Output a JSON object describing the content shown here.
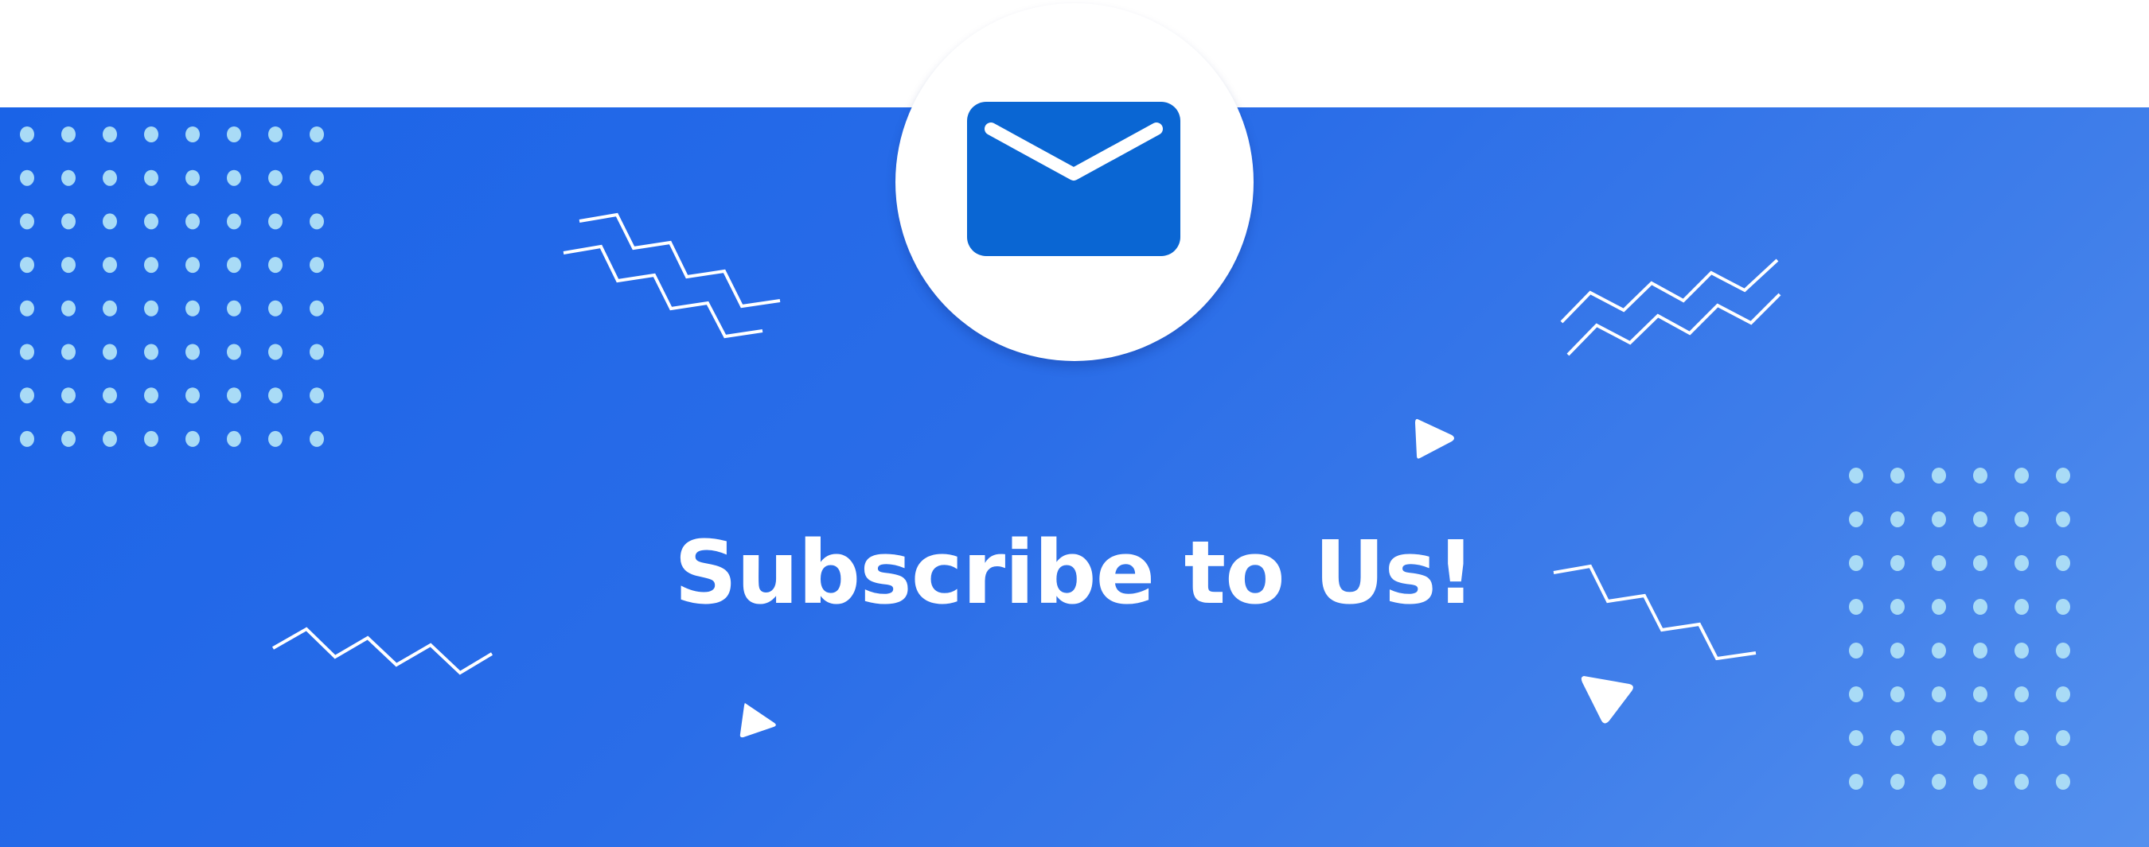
{
  "banner": {
    "headline": "Subscribe to Us!",
    "icon": "envelope-icon",
    "colors": {
      "background_start": "#1a63e7",
      "background_end": "#5490ee",
      "dot": "#a9dbf6",
      "line": "#ffffff",
      "icon_fill": "#0a66d3",
      "badge": "#ffffff"
    }
  }
}
